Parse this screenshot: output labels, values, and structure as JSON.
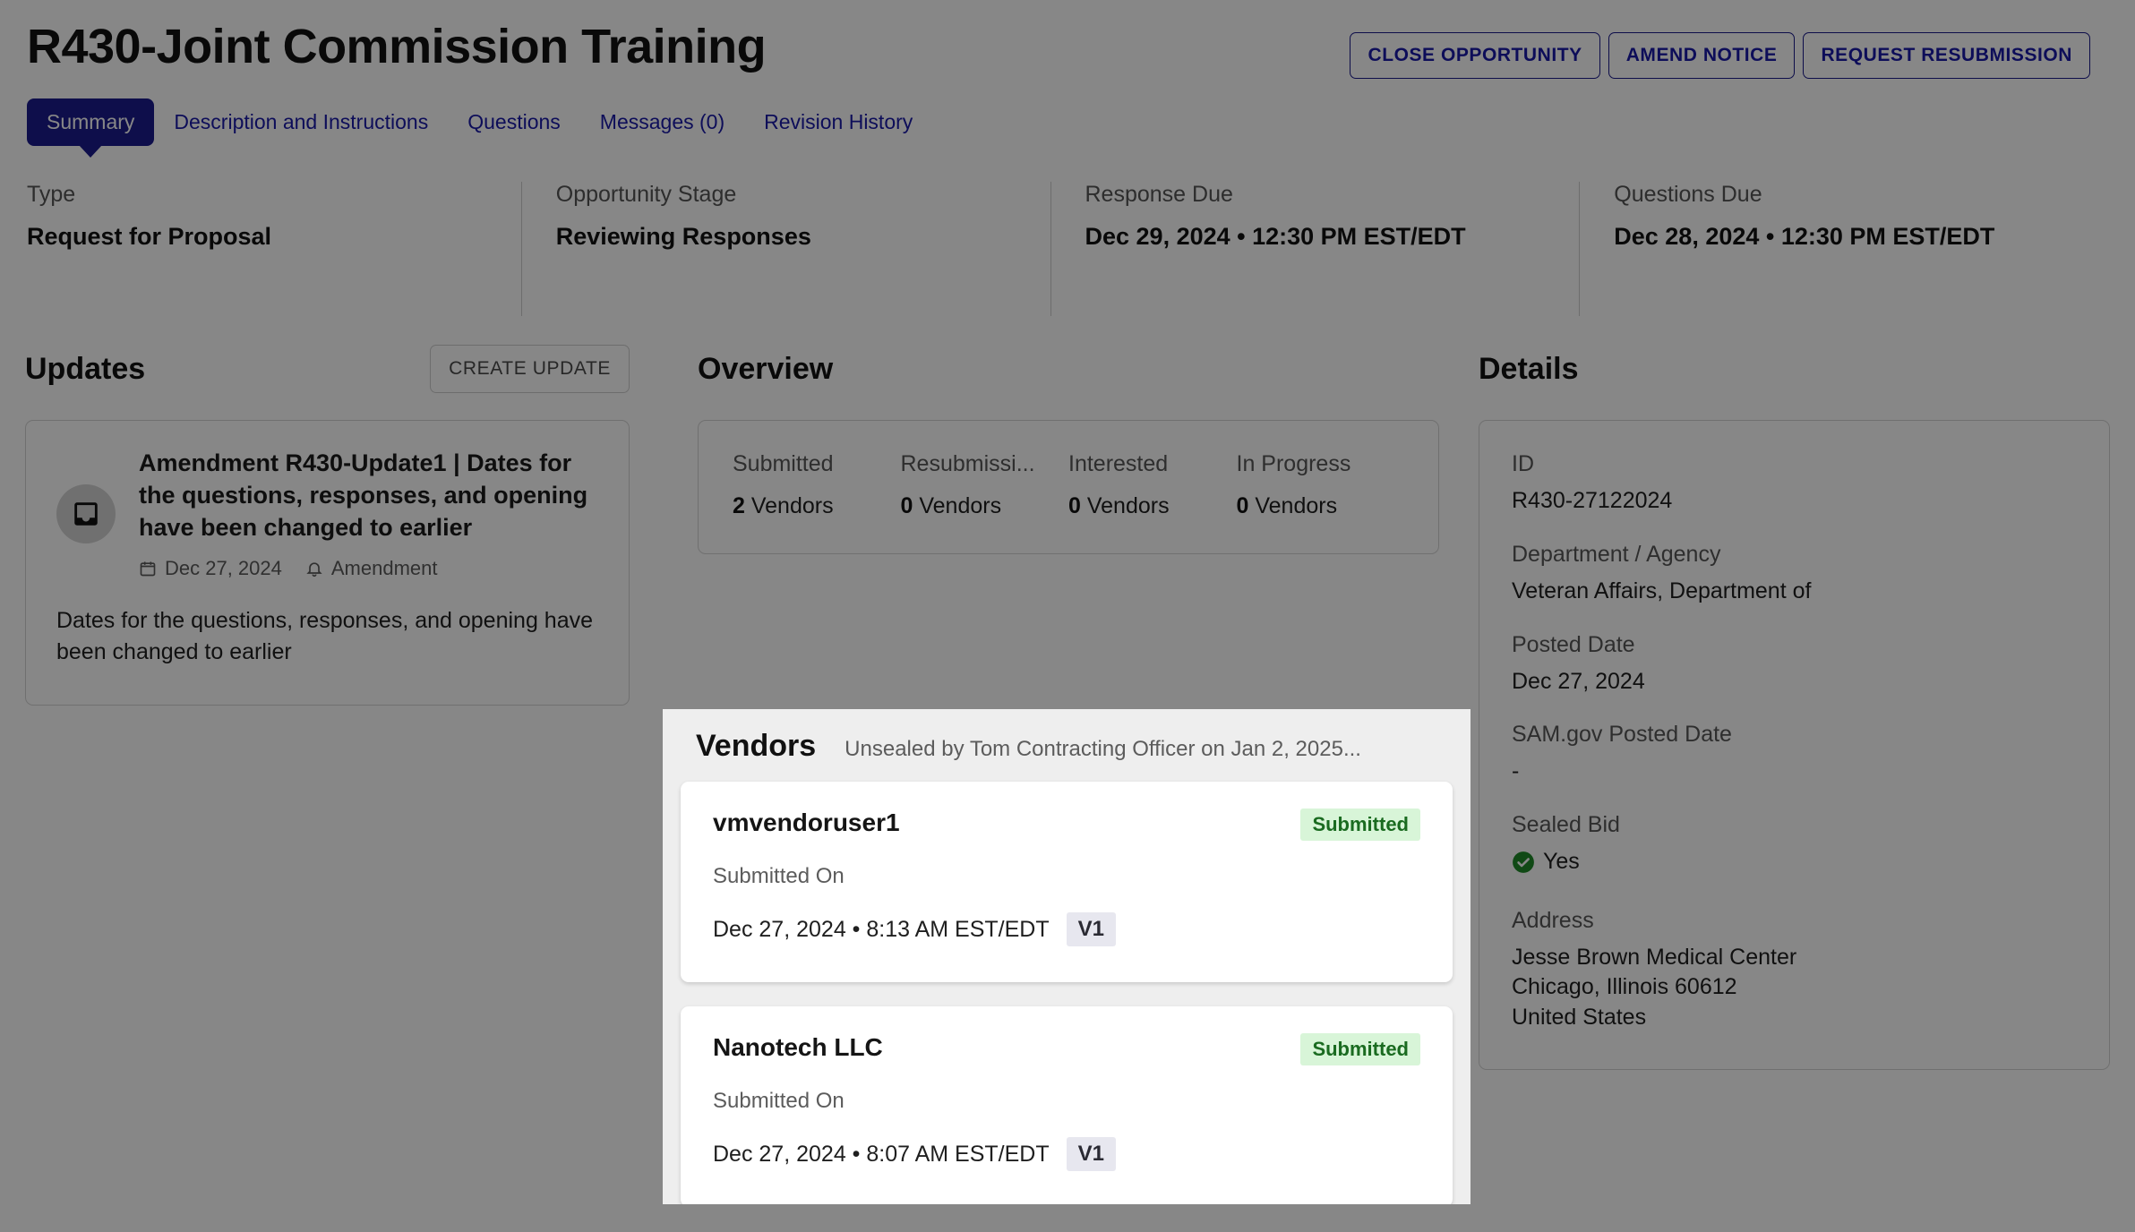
{
  "header": {
    "title": "R430-Joint Commission Training",
    "actions": [
      {
        "label": "CLOSE OPPORTUNITY",
        "name": "close-opportunity-button"
      },
      {
        "label": "AMEND NOTICE",
        "name": "amend-notice-button"
      },
      {
        "label": "REQUEST RESUBMISSION",
        "name": "request-resubmission-button"
      }
    ]
  },
  "tabs": [
    {
      "label": "Summary",
      "active": true
    },
    {
      "label": "Description and Instructions",
      "active": false
    },
    {
      "label": "Questions",
      "active": false
    },
    {
      "label": "Messages (0)",
      "active": false
    },
    {
      "label": "Revision History",
      "active": false
    }
  ],
  "summary": [
    {
      "label": "Type",
      "value": "Request for Proposal"
    },
    {
      "label": "Opportunity Stage",
      "value": "Reviewing Responses"
    },
    {
      "label": "Response Due",
      "value": "Dec 29, 2024 • 12:30 PM EST/EDT"
    },
    {
      "label": "Questions Due",
      "value": "Dec 28, 2024 • 12:30 PM EST/EDT"
    }
  ],
  "updates": {
    "title": "Updates",
    "create_button": "CREATE UPDATE",
    "card": {
      "icon": "inbox-icon",
      "title": "Amendment R430-Update1 | Dates for the questions, responses, and opening have been changed to earlier",
      "date": "Dec 27, 2024",
      "type": "Amendment",
      "body": "Dates for the questions, responses, and opening have been changed to earlier"
    }
  },
  "overview": {
    "title": "Overview",
    "stats": [
      {
        "label": "Submitted",
        "count": "2",
        "unit": "Vendors"
      },
      {
        "label": "Resubmissi...",
        "count": "0",
        "unit": "Vendors"
      },
      {
        "label": "Interested",
        "count": "0",
        "unit": "Vendors"
      },
      {
        "label": "In Progress",
        "count": "0",
        "unit": "Vendors"
      }
    ]
  },
  "vendors": {
    "title": "Vendors",
    "unsealed_note": "Unsealed by Tom Contracting Officer on Jan 2, 2025...",
    "items": [
      {
        "name": "vmvendoruser1",
        "status": "Submitted",
        "submitted_label": "Submitted On",
        "submitted_on": "Dec 27, 2024 • 8:13 AM EST/EDT",
        "version": "V1"
      },
      {
        "name": "Nanotech LLC",
        "status": "Submitted",
        "submitted_label": "Submitted On",
        "submitted_on": "Dec 27, 2024 • 8:07 AM EST/EDT",
        "version": "V1"
      }
    ]
  },
  "details": {
    "title": "Details",
    "fields": [
      {
        "label": "ID",
        "value": "R430-27122024"
      },
      {
        "label": "Department / Agency",
        "value": "Veteran Affairs, Department of"
      },
      {
        "label": "Posted Date",
        "value": "Dec 27, 2024"
      },
      {
        "label": "SAM.gov Posted Date",
        "value": "-"
      },
      {
        "label": "Sealed Bid",
        "value": "Yes",
        "icon": "check-circle-icon"
      },
      {
        "label": "Address",
        "value": "Jesse Brown Medical Center\nChicago, Illinois 60612\nUnited States"
      }
    ]
  },
  "colors": {
    "brand": "#1b1b8f",
    "link": "#1a1aa8",
    "badge_bg": "#d8f5d8",
    "badge_text": "#1a6b20",
    "chip_bg": "#e7e7ef",
    "success": "#1f8a28"
  }
}
